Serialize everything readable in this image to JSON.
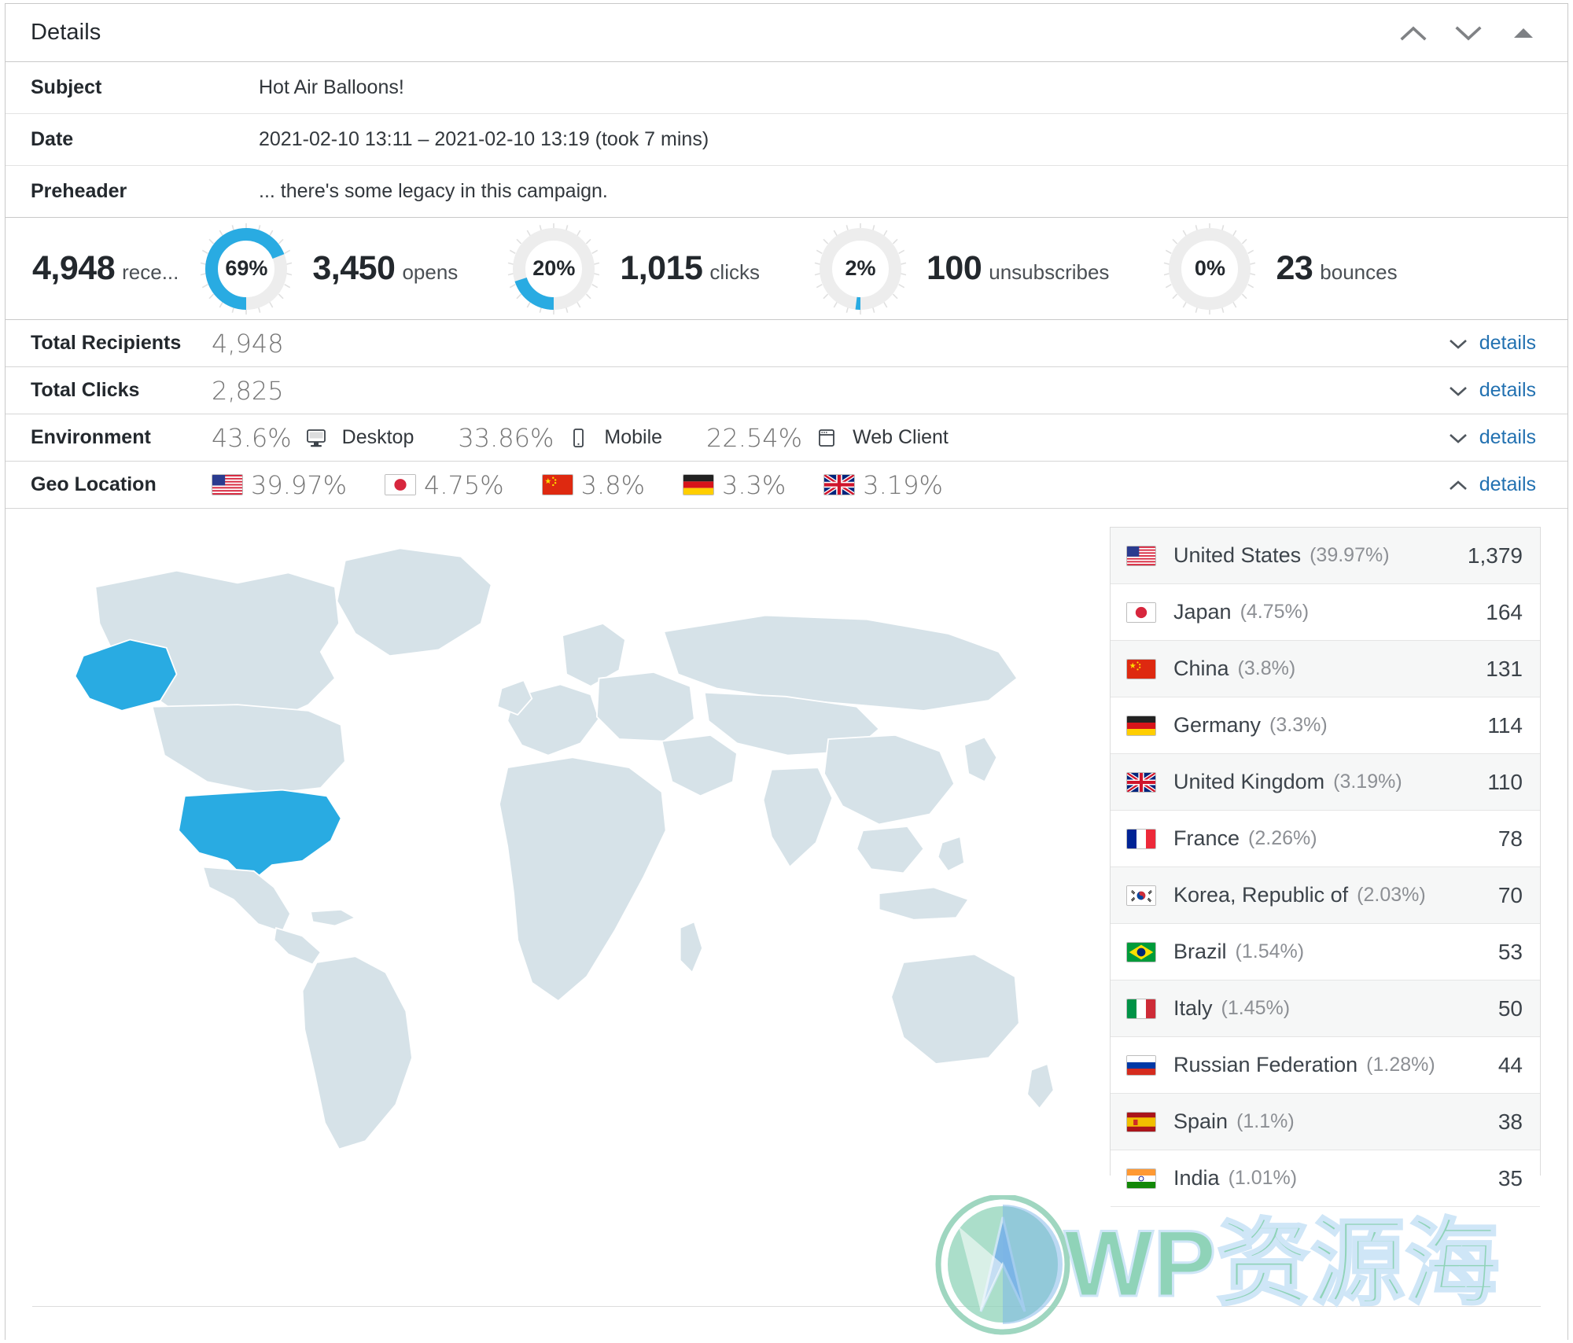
{
  "header": {
    "title": "Details",
    "icons": [
      {
        "name": "chevron-up-icon"
      },
      {
        "name": "chevron-down-icon"
      },
      {
        "name": "collapse-triangle-icon"
      }
    ]
  },
  "meta": [
    {
      "label": "Subject",
      "value": "Hot Air Balloons!"
    },
    {
      "label": "Date",
      "value": "2021-02-10 13:11 – 2021-02-10 13:19 (took 7 mins)"
    },
    {
      "label": "Preheader",
      "value": "... there's some legacy in this campaign."
    }
  ],
  "stats": {
    "recipients": {
      "number": "4,948",
      "unit": "rece..."
    },
    "items": [
      {
        "percent": "69%",
        "pct_value": 69,
        "number": "3,450",
        "unit": "opens"
      },
      {
        "percent": "20%",
        "pct_value": 20,
        "number": "1,015",
        "unit": "clicks"
      },
      {
        "percent": "2%",
        "pct_value": 2,
        "number": "100",
        "unit": "unsubscribes"
      },
      {
        "percent": "0%",
        "pct_value": 0,
        "number": "23",
        "unit": "bounces"
      }
    ]
  },
  "rows": {
    "total_recipients": {
      "label": "Total Recipients",
      "value": "4,948",
      "details": "details"
    },
    "total_clicks": {
      "label": "Total Clicks",
      "value": "2,825",
      "details": "details"
    },
    "environment": {
      "label": "Environment",
      "details": "details",
      "items": [
        {
          "percent": "43.6%",
          "icon": "desktop-icon",
          "name": "Desktop"
        },
        {
          "percent": "33.86%",
          "icon": "mobile-icon",
          "name": "Mobile"
        },
        {
          "percent": "22.54%",
          "icon": "web-client-icon",
          "name": "Web Client"
        }
      ]
    },
    "geo": {
      "label": "Geo Location",
      "details": "details",
      "items": [
        {
          "flag": "us",
          "percent": "39.97%"
        },
        {
          "flag": "jp",
          "percent": "4.75%"
        },
        {
          "flag": "cn",
          "percent": "3.8%"
        },
        {
          "flag": "de",
          "percent": "3.3%"
        },
        {
          "flag": "gb",
          "percent": "3.19%"
        }
      ]
    }
  },
  "countries": [
    {
      "flag": "us",
      "name": "United States",
      "percent": "(39.97%)",
      "count": "1,379"
    },
    {
      "flag": "jp",
      "name": "Japan",
      "percent": "(4.75%)",
      "count": "164"
    },
    {
      "flag": "cn",
      "name": "China",
      "percent": "(3.8%)",
      "count": "131"
    },
    {
      "flag": "de",
      "name": "Germany",
      "percent": "(3.3%)",
      "count": "114"
    },
    {
      "flag": "gb",
      "name": "United Kingdom",
      "percent": "(3.19%)",
      "count": "110"
    },
    {
      "flag": "fr",
      "name": "France",
      "percent": "(2.26%)",
      "count": "78"
    },
    {
      "flag": "kr",
      "name": "Korea, Republic of",
      "percent": "(2.03%)",
      "count": "70"
    },
    {
      "flag": "br",
      "name": "Brazil",
      "percent": "(1.54%)",
      "count": "53"
    },
    {
      "flag": "it",
      "name": "Italy",
      "percent": "(1.45%)",
      "count": "50"
    },
    {
      "flag": "ru",
      "name": "Russian Federation",
      "percent": "(1.28%)",
      "count": "44"
    },
    {
      "flag": "es",
      "name": "Spain",
      "percent": "(1.1%)",
      "count": "38"
    },
    {
      "flag": "in",
      "name": "India",
      "percent": "(1.01%)",
      "count": "35"
    }
  ],
  "watermark": {
    "text": "WP资源海"
  },
  "colors": {
    "accent_blue": "#29abe2",
    "link_blue": "#2271b1",
    "map_land": "#d6e2e8",
    "map_highlight": "#29abe2",
    "donut_track": "#eeeeee"
  },
  "chart_data": {
    "type": "pie",
    "title": "Campaign engagement donuts",
    "series": [
      {
        "name": "opens",
        "percent": 69,
        "count": 3450
      },
      {
        "name": "clicks",
        "percent": 20,
        "count": 1015
      },
      {
        "name": "unsubscribes",
        "percent": 2,
        "count": 100
      },
      {
        "name": "bounces",
        "percent": 0,
        "count": 23
      }
    ],
    "recipients": 4948,
    "geo_map": {
      "type": "heatmap",
      "categories": [
        "United States",
        "Japan",
        "China",
        "Germany",
        "United Kingdom",
        "France",
        "Korea, Republic of",
        "Brazil",
        "Italy",
        "Russian Federation",
        "Spain",
        "India"
      ],
      "values": [
        1379,
        164,
        131,
        114,
        110,
        78,
        70,
        53,
        50,
        44,
        38,
        35
      ],
      "percents": [
        39.97,
        4.75,
        3.8,
        3.3,
        3.19,
        2.26,
        2.03,
        1.54,
        1.45,
        1.28,
        1.1,
        1.01
      ],
      "highlighted": [
        "United States"
      ]
    }
  }
}
